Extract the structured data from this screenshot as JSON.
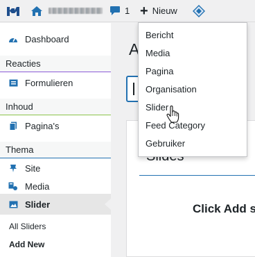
{
  "admin_bar": {
    "logo_icon": "site-logo-icon",
    "home_icon": "home-icon",
    "comments_count": "1",
    "new_label": "Nieuw",
    "new_icon": "plus-icon",
    "diamond_icon": "diamond-icon"
  },
  "new_menu": {
    "items": [
      {
        "label": "Bericht"
      },
      {
        "label": "Media"
      },
      {
        "label": "Pagina"
      },
      {
        "label": "Organisation"
      },
      {
        "label": "Slider"
      },
      {
        "label": "Feed Category"
      },
      {
        "label": "Gebruiker"
      }
    ],
    "hovered": "Slider"
  },
  "sidebar": {
    "dashboard": "Dashboard",
    "sections": {
      "reacties": "Reacties",
      "inhoud": "Inhoud",
      "thema": "Thema"
    },
    "formulieren": "Formulieren",
    "paginas": "Pagina's",
    "site": "Site",
    "media": "Media",
    "slider": "Slider",
    "submenu": {
      "all_sliders": "All Sliders",
      "add_new": "Add New"
    },
    "section_colors": {
      "reacties": "#8c5bd8",
      "inhoud": "#8bc34a",
      "thema": "#2271b1"
    }
  },
  "main": {
    "heading_fragment": "A",
    "panel_title": "Slides",
    "empty_message": "Click Add s"
  },
  "colors": {
    "accent": "#2271b1",
    "text": "#1d2327",
    "background": "#f0f0f1"
  }
}
